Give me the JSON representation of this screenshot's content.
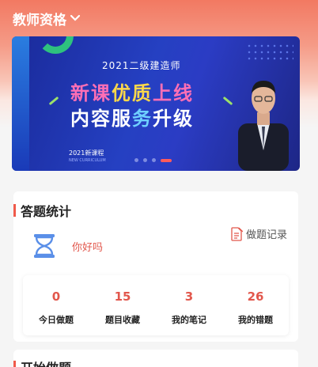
{
  "header": {
    "title": "教师资格",
    "chevron_icon": "chevron-down-icon"
  },
  "banner": {
    "subtitle": "2021二级建造师",
    "line1_a": "新课",
    "line1_b": "优质",
    "line1_c": "上线",
    "line2_a": "内容服",
    "line2_b": "务",
    "line2_c": "升级",
    "tag": "2021新课程",
    "tag_en": "NEW CURRICULUM",
    "pages": 4,
    "active_page": 4
  },
  "stats_card": {
    "title": "答题统计",
    "greeting": "你好吗",
    "record_link": "做题记录",
    "items": [
      {
        "value": "0",
        "label": "今日做题"
      },
      {
        "value": "15",
        "label": "题目收藏"
      },
      {
        "value": "3",
        "label": "我的笔记"
      },
      {
        "value": "26",
        "label": "我的错题"
      }
    ]
  },
  "next_card": {
    "title": "开始做题"
  },
  "colors": {
    "accent": "#e2574c",
    "header_bg": "#f27962"
  }
}
